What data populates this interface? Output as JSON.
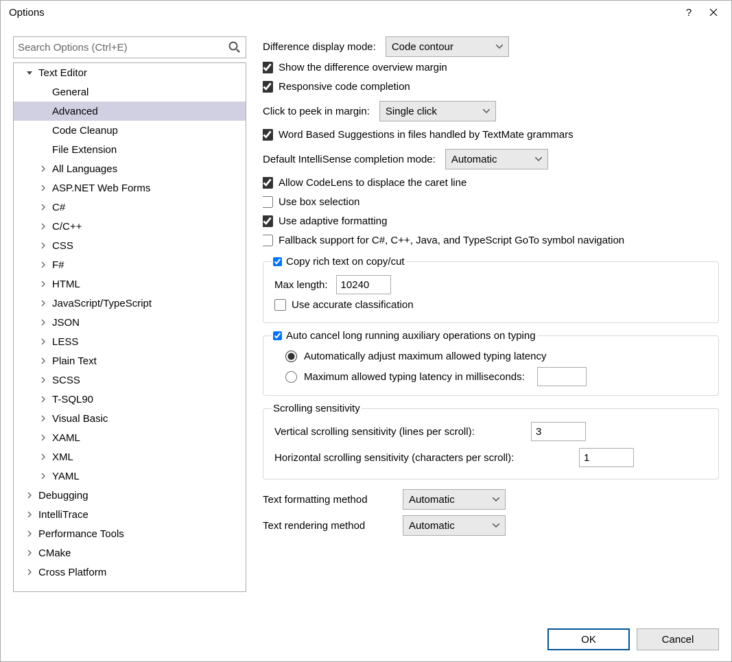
{
  "window": {
    "title": "Options"
  },
  "search": {
    "placeholder": "Search Options (Ctrl+E)"
  },
  "tree": {
    "items": [
      {
        "label": "Text Editor",
        "level": 0,
        "expanded": true
      },
      {
        "label": "General",
        "level": 1,
        "leaf": true
      },
      {
        "label": "Advanced",
        "level": 1,
        "leaf": true,
        "selected": true
      },
      {
        "label": "Code Cleanup",
        "level": 1,
        "leaf": true
      },
      {
        "label": "File Extension",
        "level": 1,
        "leaf": true
      },
      {
        "label": "All Languages",
        "level": 1
      },
      {
        "label": "ASP.NET Web Forms",
        "level": 1
      },
      {
        "label": "C#",
        "level": 1
      },
      {
        "label": "C/C++",
        "level": 1
      },
      {
        "label": "CSS",
        "level": 1
      },
      {
        "label": "F#",
        "level": 1
      },
      {
        "label": "HTML",
        "level": 1
      },
      {
        "label": "JavaScript/TypeScript",
        "level": 1
      },
      {
        "label": "JSON",
        "level": 1
      },
      {
        "label": "LESS",
        "level": 1
      },
      {
        "label": "Plain Text",
        "level": 1
      },
      {
        "label": "SCSS",
        "level": 1
      },
      {
        "label": "T-SQL90",
        "level": 1
      },
      {
        "label": "Visual Basic",
        "level": 1
      },
      {
        "label": "XAML",
        "level": 1
      },
      {
        "label": "XML",
        "level": 1
      },
      {
        "label": "YAML",
        "level": 1
      },
      {
        "label": "Debugging",
        "level": 0
      },
      {
        "label": "IntelliTrace",
        "level": 0
      },
      {
        "label": "Performance Tools",
        "level": 0
      },
      {
        "label": "CMake",
        "level": 0
      },
      {
        "label": "Cross Platform",
        "level": 0
      }
    ]
  },
  "settings": {
    "diff_mode_label": "Difference display mode:",
    "diff_mode_value": "Code contour",
    "show_diff_margin": "Show the difference overview margin",
    "responsive_completion": "Responsive code completion",
    "click_peek_label": "Click to peek in margin:",
    "click_peek_value": "Single click",
    "word_based": "Word Based Suggestions in files handled by TextMate grammars",
    "intellisense_label": "Default IntelliSense completion mode:",
    "intellisense_value": "Automatic",
    "codelens": "Allow CodeLens to displace the caret line",
    "box_selection": "Use box selection",
    "adaptive_formatting": "Use adaptive formatting",
    "fallback": "Fallback support for C#, C++, Java, and TypeScript GoTo symbol navigation",
    "copy_rich_text": "Copy rich text on copy/cut",
    "max_length_label": "Max length:",
    "max_length_value": "10240",
    "use_accurate": "Use accurate classification",
    "auto_cancel": "Auto cancel long running auxiliary operations on typing",
    "auto_adjust": "Automatically adjust maximum allowed typing latency",
    "max_latency": "Maximum allowed typing latency in milliseconds:",
    "scroll_legend": "Scrolling sensitivity",
    "vscroll_label": "Vertical scrolling sensitivity (lines per scroll):",
    "vscroll_value": "3",
    "hscroll_label": "Horizontal scrolling sensitivity (characters per scroll):",
    "hscroll_value": "1",
    "formatting_method_label": "Text formatting method",
    "formatting_method_value": "Automatic",
    "rendering_method_label": "Text rendering method",
    "rendering_method_value": "Automatic"
  },
  "buttons": {
    "ok": "OK",
    "cancel": "Cancel"
  }
}
